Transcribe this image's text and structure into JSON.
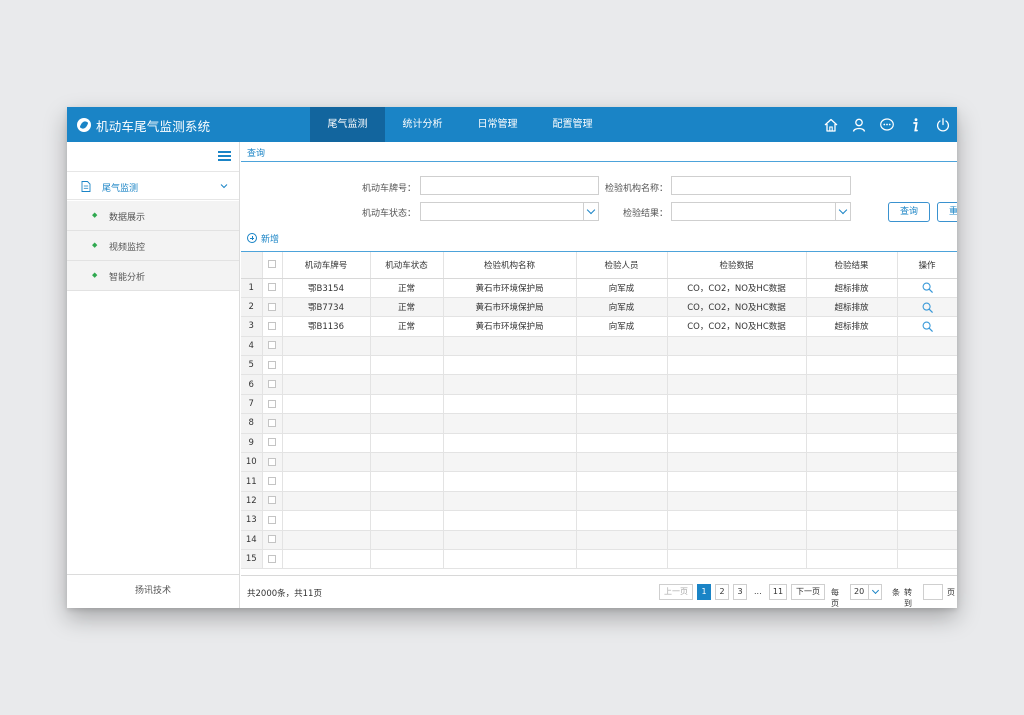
{
  "app": {
    "title": "机动车尾气监测系统"
  },
  "nav": {
    "items": [
      {
        "label": "尾气监测",
        "active": true
      },
      {
        "label": "统计分析",
        "active": false
      },
      {
        "label": "日常管理",
        "active": false
      },
      {
        "label": "配置管理",
        "active": false
      }
    ]
  },
  "top_icons": [
    "home-icon",
    "user-icon",
    "message-icon",
    "info-icon",
    "power-icon"
  ],
  "sidebar": {
    "group": {
      "label": "尾气监测",
      "icon": "document-icon",
      "expanded": true
    },
    "items": [
      {
        "label": "数据展示"
      },
      {
        "label": "视频监控"
      },
      {
        "label": "智能分析"
      }
    ],
    "footer": "扬讯技术"
  },
  "breadcrumb": "查询",
  "form": {
    "plate_label": "机动车牌号：",
    "plate_value": "",
    "org_label": "检验机构名称：",
    "org_value": "",
    "status_label": "机动车状态：",
    "status_value": "",
    "result_label": "检验结果：",
    "result_value": "",
    "search_button": "查询",
    "reset_button": "重置"
  },
  "add_link": "新增",
  "table": {
    "columns": [
      "机动车牌号",
      "机动车状态",
      "检验机构名称",
      "检验人员",
      "检验数据",
      "检验结果",
      "操作"
    ],
    "rows": [
      {
        "no": "1",
        "plate": "鄂B3154",
        "status": "正常",
        "org": "黄石市环境保护局",
        "inspector": "向军成",
        "data": "CO，CO2，NO及HC数据",
        "result": "超标排放"
      },
      {
        "no": "2",
        "plate": "鄂B7734",
        "status": "正常",
        "org": "黄石市环境保护局",
        "inspector": "向军成",
        "data": "CO，CO2，NO及HC数据",
        "result": "超标排放"
      },
      {
        "no": "3",
        "plate": "鄂B1136",
        "status": "正常",
        "org": "黄石市环境保护局",
        "inspector": "向军成",
        "data": "CO，CO2，NO及HC数据",
        "result": "超标排放"
      }
    ],
    "empty_row_numbers": [
      "4",
      "5",
      "6",
      "7",
      "8",
      "9",
      "10",
      "11",
      "12",
      "13",
      "14",
      "15"
    ]
  },
  "pagination": {
    "summary": "共2000条，共11页",
    "prev": "上一页",
    "pages": [
      "1",
      "2",
      "3"
    ],
    "current_page": "1",
    "ellipsis": "...",
    "last_page": "11",
    "next": "下一页",
    "per_page_label": "每页",
    "per_page_value": "20",
    "per_page_unit": "条",
    "goto_label": "转到",
    "goto_unit": "页"
  },
  "colors": {
    "primary": "#1a84c6",
    "nav_active": "#12659e",
    "sidebar_bullet": "#2fa84f"
  }
}
